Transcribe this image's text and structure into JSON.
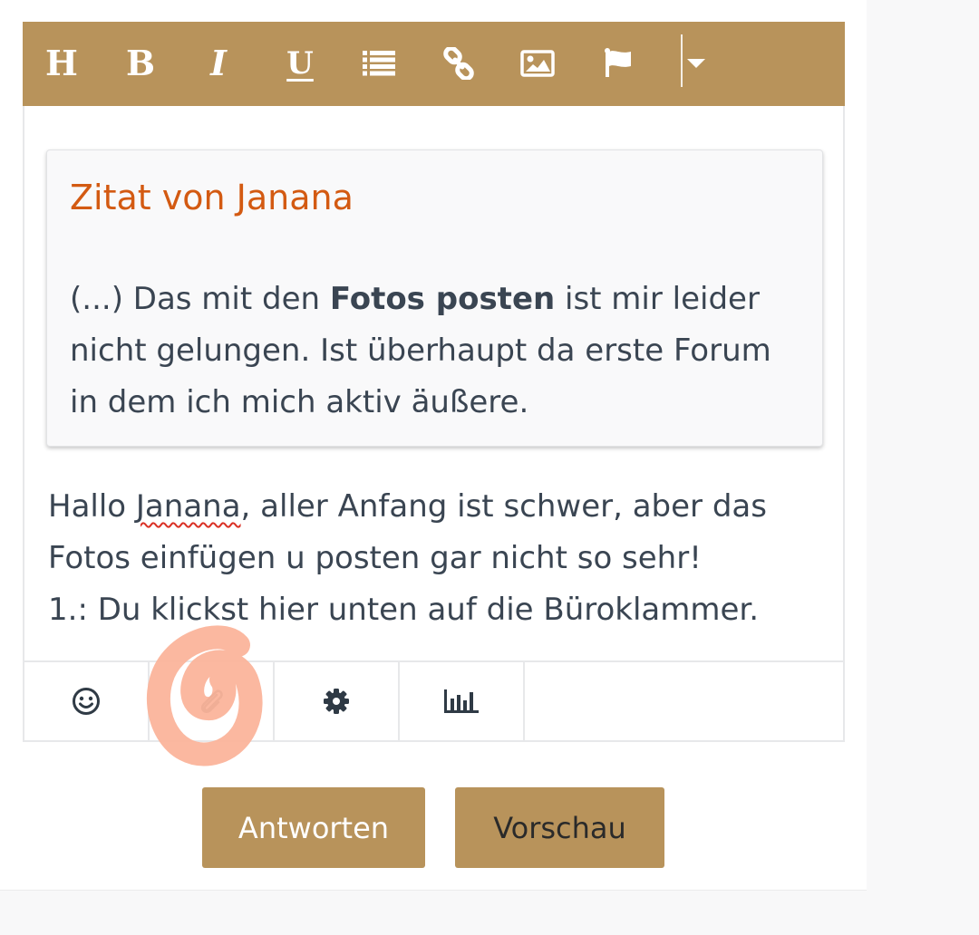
{
  "colors": {
    "accent": "#b8935b",
    "quote_title": "#d35a12",
    "body_text": "#3a4552",
    "annotation_marker": "#fbb49b"
  },
  "toolbar": {
    "heading_label": "H",
    "bold_label": "B",
    "italic_label": "I",
    "underline_label": "U",
    "icons": [
      "list-icon",
      "link-icon",
      "image-icon",
      "flag-icon",
      "chevron-down-icon"
    ]
  },
  "quote": {
    "title": "Zitat von Janana",
    "text_before": "(...) Das mit den ",
    "text_bold": "Fotos posten",
    "text_after": " ist mir leider nicht gelungen. Ist überhaupt da erste Forum in dem ich mich aktiv äußere."
  },
  "reply": {
    "line1_before": "Hallo ",
    "line1_misspelled": "Janana",
    "line1_after": ", aller Anfang ist schwer, aber das",
    "line2": "Fotos einfügen u posten gar nicht so sehr!",
    "line3": "1.: Du klickst hier unten auf die Büroklammer."
  },
  "bottom_toolbar": {
    "icons": [
      "smiley-icon",
      "paperclip-icon",
      "gear-icon",
      "bar-chart-icon"
    ]
  },
  "buttons": {
    "reply_label": "Antworten",
    "preview_label": "Vorschau"
  }
}
